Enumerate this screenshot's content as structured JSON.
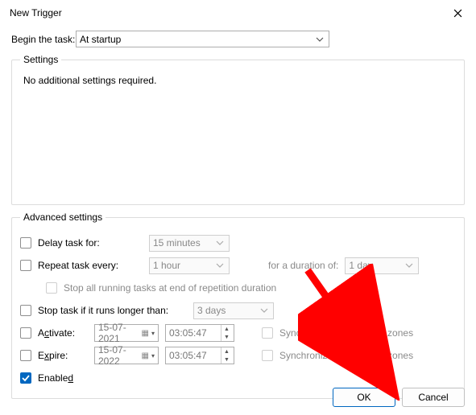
{
  "window": {
    "title": "New Trigger"
  },
  "begin": {
    "label": "Begin the task:",
    "value": "At startup"
  },
  "settings": {
    "legend": "Settings",
    "message": "No additional settings required."
  },
  "advanced": {
    "legend": "Advanced settings",
    "delay": {
      "label": "Delay task for:",
      "combo": "15 minutes"
    },
    "repeat": {
      "label": "Repeat task every:",
      "combo": "1 hour",
      "duration_label": "for a duration of:",
      "duration_value": "1 day",
      "stop_label": "Stop all running tasks at end of repetition duration"
    },
    "stop_if": {
      "label": "Stop task if it runs longer than:",
      "combo": "3 days"
    },
    "activate": {
      "label_pre": "A",
      "label_u": "c",
      "label_post": "tivate:",
      "date": "15-07-2021",
      "time": "03:05:47",
      "sync": "Synchronize across time zones"
    },
    "expire": {
      "label_pre": "E",
      "label_u": "x",
      "label_post": "pire:",
      "date": "15-07-2022",
      "time": "03:05:47",
      "sync": "Synchronize across time zones"
    },
    "enabled": {
      "label_pre": "Enable",
      "label_u": "d",
      "checked": true
    }
  },
  "buttons": {
    "ok": "OK",
    "cancel": "Cancel"
  }
}
